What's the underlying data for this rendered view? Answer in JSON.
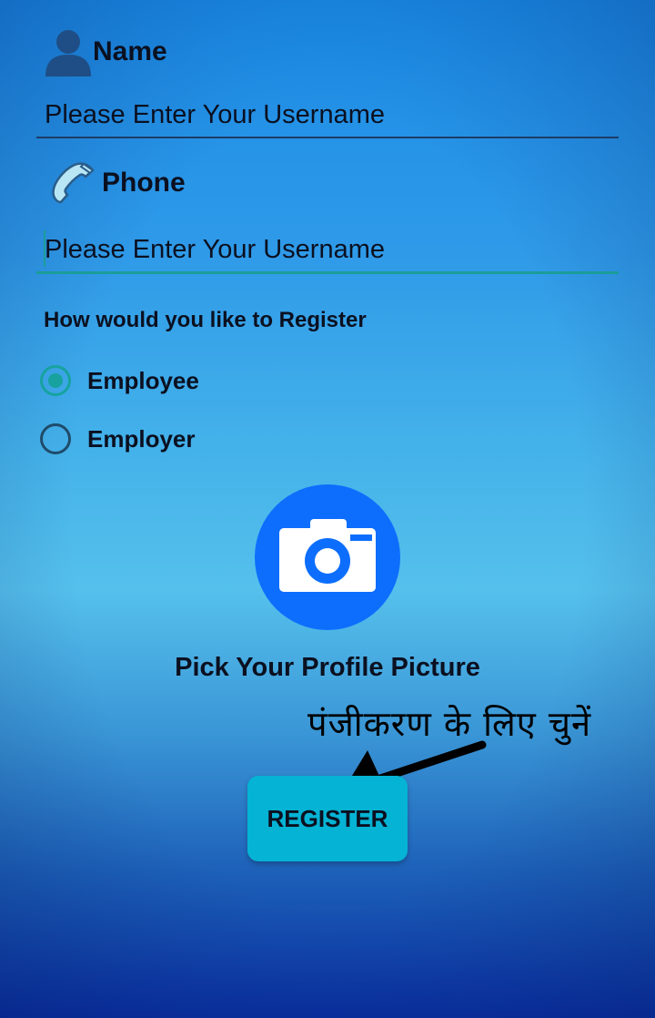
{
  "form": {
    "name": {
      "label": "Name",
      "icon": "person-icon",
      "placeholder": "Please Enter Your Username",
      "value": ""
    },
    "phone": {
      "label": "Phone",
      "icon": "phone-icon",
      "placeholder": "Please Enter Your Username",
      "value": ""
    },
    "register_as": {
      "question": "How would you like to Register",
      "options": [
        {
          "label": "Employee",
          "selected": true
        },
        {
          "label": "Employer",
          "selected": false
        }
      ]
    },
    "profile_picture": {
      "icon": "camera-icon",
      "label": "Pick Your Profile Picture"
    },
    "register_button": {
      "label": "REGISTER"
    }
  },
  "annotation": {
    "text": "पंजीकरण के लिए चुनें",
    "icon": "arrow-icon"
  },
  "colors": {
    "accent": "#17a2a0",
    "camera_button": "#0d6efd",
    "register_button": "#05b3d4",
    "text": "#0b1020"
  }
}
